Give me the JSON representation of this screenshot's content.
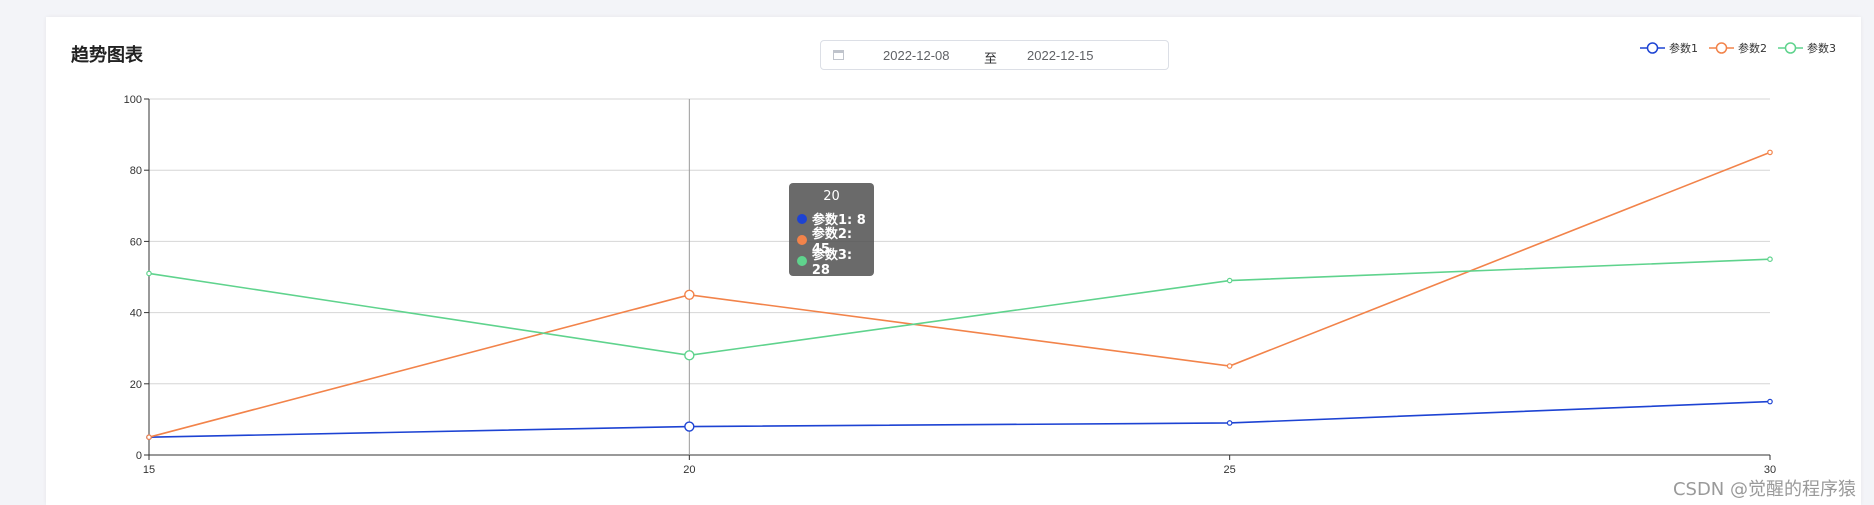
{
  "card": {
    "title": "趋势图表"
  },
  "date_picker": {
    "icon": "calendar-icon",
    "start": "2022-12-08",
    "separator": "至",
    "end": "2022-12-15"
  },
  "tooltip": {
    "title": "20",
    "rows": [
      {
        "label": "参数1: 8",
        "color": "#1d43d3"
      },
      {
        "label": "参数2: 45",
        "color": "#f2834a"
      },
      {
        "label": "参数3: 28",
        "color": "#5fd38d"
      }
    ]
  },
  "watermark": "CSDN @觉醒的程序猿",
  "chart_data": {
    "type": "line",
    "title": "",
    "xlabel": "",
    "ylabel": "",
    "x": [
      15,
      20,
      25,
      30
    ],
    "x_ticks": [
      "15",
      "20",
      "25",
      "30"
    ],
    "y_ticks": [
      "0",
      "20",
      "40",
      "60",
      "80",
      "100"
    ],
    "xlim": [
      15,
      30
    ],
    "ylim": [
      0,
      100
    ],
    "grid": "horizontal",
    "legend_position": "top-right",
    "highlighted_x": 20,
    "series": [
      {
        "name": "参数1",
        "color": "#1d43d3",
        "values": [
          5,
          8,
          9,
          15
        ]
      },
      {
        "name": "参数2",
        "color": "#f2834a",
        "values": [
          5,
          45,
          25,
          85
        ]
      },
      {
        "name": "参数3",
        "color": "#5fd38d",
        "values": [
          51,
          28,
          49,
          55
        ]
      }
    ]
  }
}
